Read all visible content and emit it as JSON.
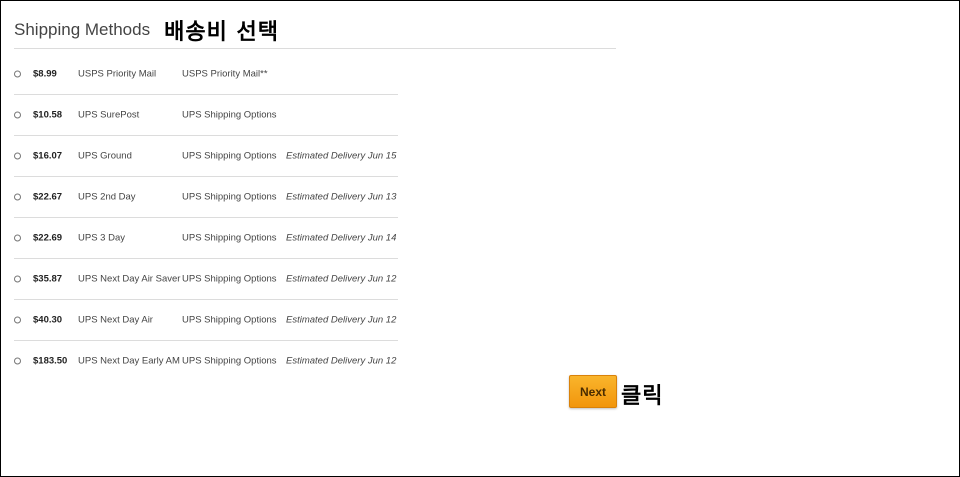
{
  "header": {
    "title": "Shipping Methods",
    "annotation": "배송비 선택"
  },
  "methods": [
    {
      "price": "$8.99",
      "service": "USPS Priority Mail",
      "carrier": "USPS Priority Mail**",
      "eta": ""
    },
    {
      "price": "$10.58",
      "service": "UPS SurePost",
      "carrier": "UPS Shipping Options",
      "eta": ""
    },
    {
      "price": "$16.07",
      "service": "UPS Ground",
      "carrier": "UPS Shipping Options",
      "eta": "Estimated Delivery Jun 15"
    },
    {
      "price": "$22.67",
      "service": "UPS 2nd Day",
      "carrier": "UPS Shipping Options",
      "eta": "Estimated Delivery Jun 13"
    },
    {
      "price": "$22.69",
      "service": "UPS 3 Day",
      "carrier": "UPS Shipping Options",
      "eta": "Estimated Delivery Jun 14"
    },
    {
      "price": "$35.87",
      "service": "UPS Next Day Air Saver",
      "carrier": "UPS Shipping Options",
      "eta": "Estimated Delivery Jun 12"
    },
    {
      "price": "$40.30",
      "service": "UPS Next Day Air",
      "carrier": "UPS Shipping Options",
      "eta": "Estimated Delivery Jun 12"
    },
    {
      "price": "$183.50",
      "service": "UPS Next Day Early AM",
      "carrier": "UPS Shipping Options",
      "eta": "Estimated Delivery Jun 12"
    }
  ],
  "next_button": {
    "label": "Next",
    "annotation": "클릭"
  },
  "colors": {
    "accent": "#f5a623",
    "divider": "#dcdcdc"
  }
}
